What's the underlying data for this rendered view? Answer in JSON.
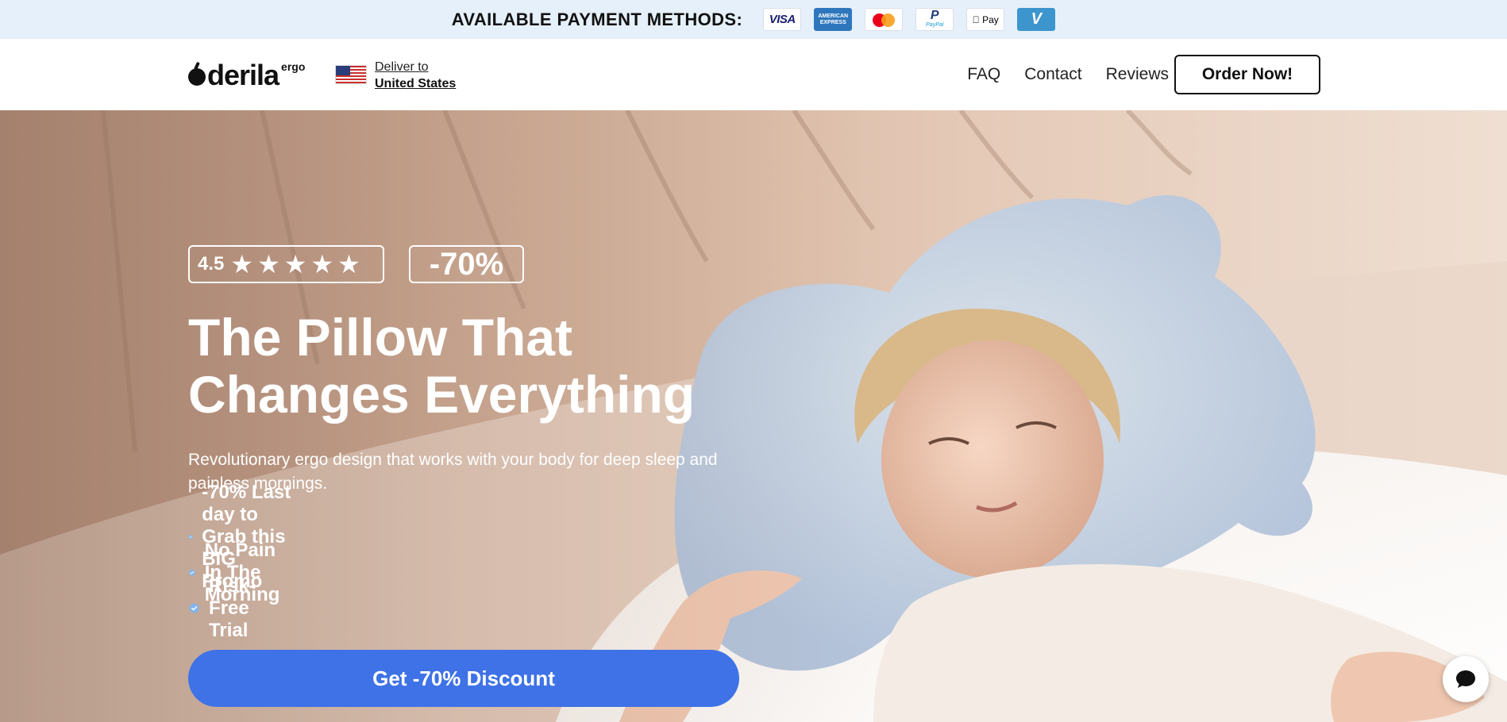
{
  "payment_bar": {
    "label": "AVAILABLE PAYMENT METHODS:",
    "methods": [
      {
        "name": "visa",
        "text": "VISA"
      },
      {
        "name": "amex",
        "text": "AMERICAN EXPRESS"
      },
      {
        "name": "mastercard",
        "text": ""
      },
      {
        "name": "paypal",
        "text": "PayPal"
      },
      {
        "name": "apple-pay",
        "text": "Pay"
      },
      {
        "name": "venmo",
        "text": "V"
      }
    ]
  },
  "header": {
    "logo_text": "derila",
    "logo_suffix": "ergo",
    "deliver_label": "Deliver to",
    "deliver_country": "United States",
    "nav": [
      "FAQ",
      "Contact",
      "Reviews"
    ],
    "order_button": "Order Now!"
  },
  "hero": {
    "rating": "4.5",
    "stars": 5,
    "discount_badge": "-70%",
    "headline_line1": "The Pillow That",
    "headline_line2": "Changes Everything",
    "subtext": "Revolutionary ergo design that works with your body for deep sleep and painless mornings.",
    "bullets": [
      "-70% Last day to Grab this BIG Promo",
      "No Pain In The Morning",
      "Risk-Free Trial"
    ],
    "cta": "Get -70% Discount"
  },
  "colors": {
    "payment_bar_bg": "#e6f0fb",
    "cta_blue": "#3e72e6",
    "check_blue": "#7eb6f0"
  }
}
